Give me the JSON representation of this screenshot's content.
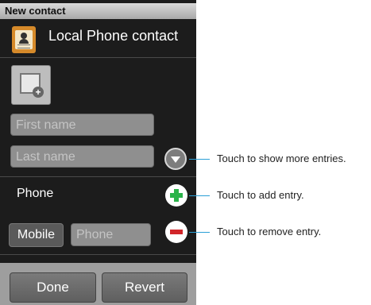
{
  "titlebar": {
    "title": "New contact"
  },
  "account": {
    "label": "Local Phone contact",
    "icon": "contact-card-icon"
  },
  "photo": {
    "icon": "add-photo-icon"
  },
  "fields": {
    "first_name_placeholder": "First name",
    "last_name_placeholder": "Last name"
  },
  "phone_section": {
    "label": "Phone",
    "type_label": "Mobile",
    "phone_placeholder": "Phone"
  },
  "buttons": {
    "more_icon": "expand-down-icon",
    "add_icon": "plus-icon",
    "remove_icon": "minus-icon",
    "done": "Done",
    "revert": "Revert"
  },
  "callouts": {
    "more": "Touch to show more entries.",
    "add": "Touch to add entry.",
    "remove": "Touch to remove entry."
  },
  "colors": {
    "add_green": "#2bb34a",
    "remove_red": "#d1262a",
    "callout_line": "#2a9fd6"
  }
}
